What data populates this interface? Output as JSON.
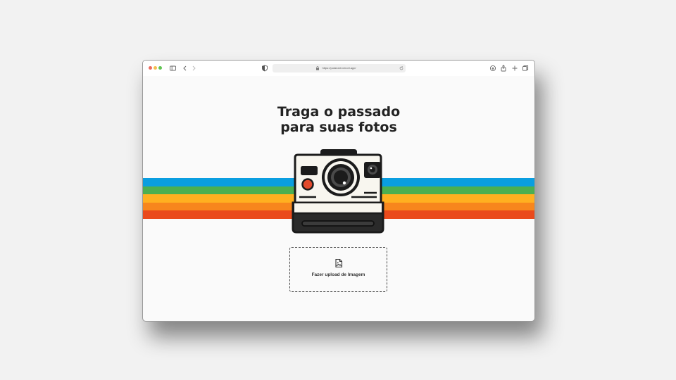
{
  "browser": {
    "url": "https://polaroidr.vercel.app/",
    "icons": [
      "sidebar-icon",
      "back-icon",
      "forward-icon",
      "shield-icon",
      "lock-icon",
      "reload-icon",
      "download-icon",
      "share-icon",
      "new-tab-icon",
      "tabs-overview-icon"
    ]
  },
  "hero": {
    "line1": "Traga o passado",
    "line2": "para suas fotos"
  },
  "stripes": [
    "#0a9ee0",
    "#4caf50",
    "#ffb020",
    "#f7861d",
    "#ea4a1c"
  ],
  "upload": {
    "label": "Fazer upload de Imagem",
    "icon": "image-file-icon"
  }
}
